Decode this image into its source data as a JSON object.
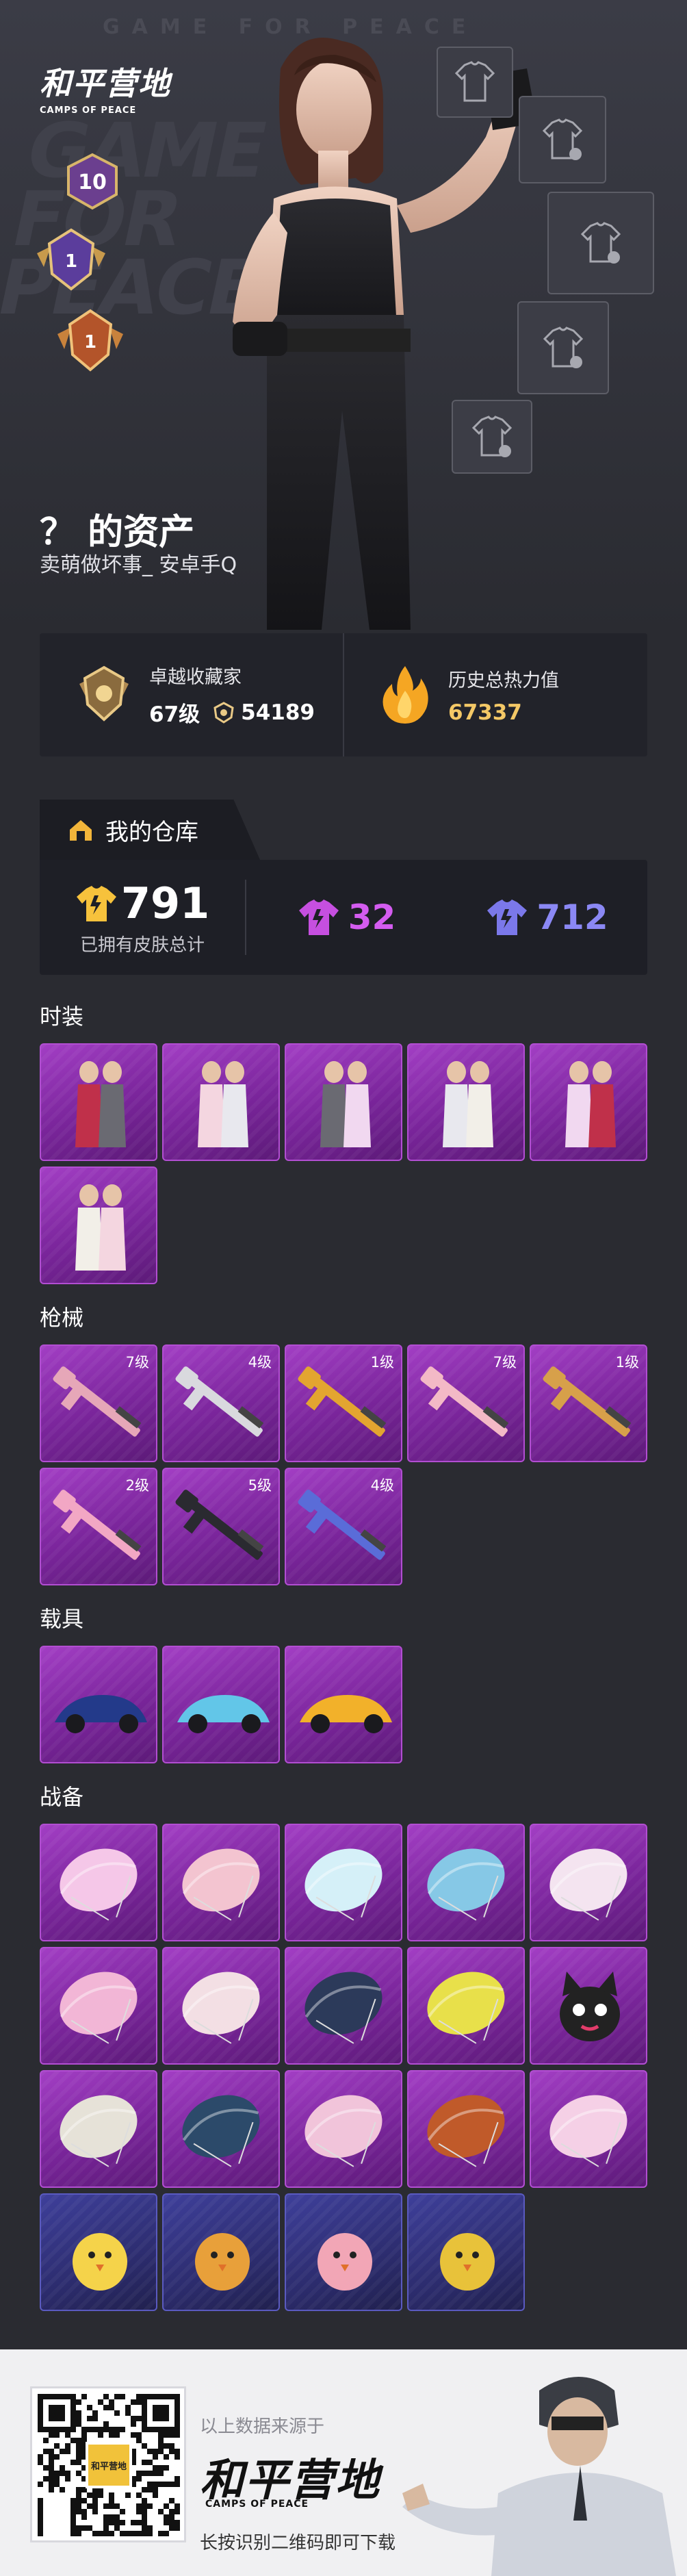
{
  "brand": {
    "name_cn": "和平营地",
    "name_en": "CAMPS OF PEACE",
    "watermark": "GAME FOR PEACE",
    "bg_text": "GAME FOR PEACE"
  },
  "profile": {
    "title": "？ 的资产",
    "subtitle": "卖萌做坏事_   安卓手Q",
    "badges": [
      {
        "label": "10"
      },
      {
        "label": "1"
      },
      {
        "label": "1"
      }
    ]
  },
  "stats": [
    {
      "label": "卓越收藏家",
      "level": "67级",
      "points": "54189",
      "icon": "collector-badge-icon"
    },
    {
      "label": "历史总热力值",
      "value": "67337",
      "icon": "flame-icon"
    }
  ],
  "warehouse": {
    "tab_label": "我的仓库",
    "total": "791",
    "total_caption": "已拥有皮肤总计",
    "purple_count": "32",
    "blue_count": "712",
    "colors": {
      "gold": "#f7c23c",
      "purple": "#c64fe0",
      "blue": "#7b78ea"
    }
  },
  "sections": [
    {
      "title": "时装",
      "items": [
        {
          "name": "outfit-item",
          "level": ""
        },
        {
          "name": "outfit-item",
          "level": ""
        },
        {
          "name": "outfit-item",
          "level": ""
        },
        {
          "name": "outfit-item",
          "level": ""
        },
        {
          "name": "outfit-item",
          "level": ""
        },
        {
          "name": "outfit-item",
          "level": ""
        }
      ]
    },
    {
      "title": "枪械",
      "items": [
        {
          "name": "rifle-item",
          "level": "7级"
        },
        {
          "name": "rifle-item",
          "level": "4级"
        },
        {
          "name": "rifle-item",
          "level": "1级"
        },
        {
          "name": "rifle-item",
          "level": "7级"
        },
        {
          "name": "rifle-item",
          "level": "1级"
        },
        {
          "name": "rifle-item",
          "level": "2级"
        },
        {
          "name": "rifle-item",
          "level": "5级"
        },
        {
          "name": "rifle-item",
          "level": "4级"
        }
      ]
    },
    {
      "title": "载具",
      "items": [
        {
          "name": "vehicle-item",
          "level": ""
        },
        {
          "name": "vehicle-item",
          "level": ""
        },
        {
          "name": "vehicle-item",
          "level": ""
        }
      ]
    },
    {
      "title": "战备",
      "items": [
        {
          "name": "gear-item",
          "level": ""
        },
        {
          "name": "gear-item",
          "level": ""
        },
        {
          "name": "gear-item",
          "level": ""
        },
        {
          "name": "gear-item",
          "level": ""
        },
        {
          "name": "gear-item",
          "level": ""
        },
        {
          "name": "gear-item",
          "level": ""
        },
        {
          "name": "gear-item",
          "level": ""
        },
        {
          "name": "gear-item",
          "level": ""
        },
        {
          "name": "gear-item",
          "level": ""
        },
        {
          "name": "gear-item",
          "level": ""
        },
        {
          "name": "gear-item",
          "level": ""
        },
        {
          "name": "gear-item",
          "level": ""
        },
        {
          "name": "gear-item",
          "level": ""
        },
        {
          "name": "gear-item",
          "level": ""
        },
        {
          "name": "gear-item",
          "level": ""
        },
        {
          "name": "gear-item",
          "level": ""
        },
        {
          "name": "gear-item",
          "level": ""
        },
        {
          "name": "gear-item",
          "level": ""
        },
        {
          "name": "gear-item",
          "level": ""
        }
      ]
    }
  ],
  "footer": {
    "source_text": "以上数据来源于",
    "logo_cn": "和平营地",
    "logo_en": "CAMPS OF PEACE",
    "tip": "长按识别二维码即可下载",
    "qr_logo": "和平营地"
  }
}
